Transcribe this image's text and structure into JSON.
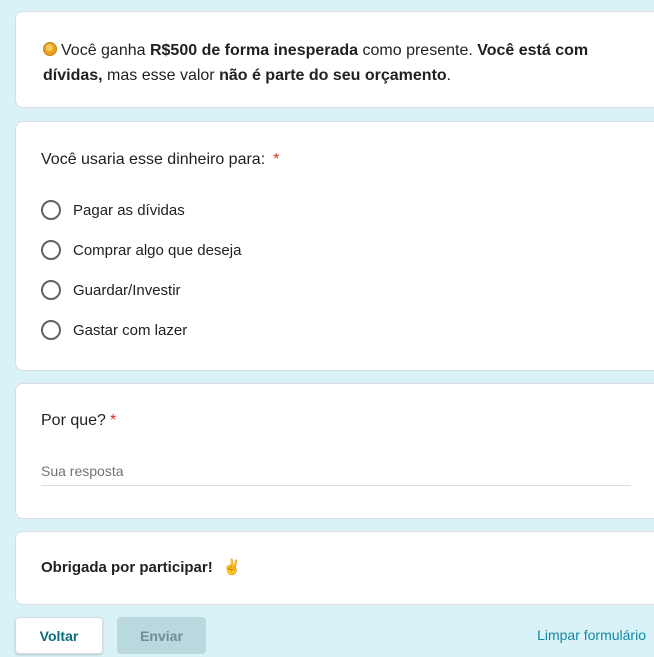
{
  "intro": {
    "text_1": "Você ganha ",
    "bold_1": "R$500 de forma inesperada",
    "text_2": " como presente. ",
    "bold_2": "Você está com dívidas,",
    "text_3": " mas esse valor ",
    "bold_3": "não é parte do seu orçamento",
    "text_4": "."
  },
  "question1": {
    "title": "Você usaria esse dinheiro para:",
    "required_mark": "*",
    "options": [
      "Pagar as dívidas",
      "Comprar algo que deseja",
      "Guardar/Investir",
      "Gastar com lazer"
    ]
  },
  "question2": {
    "title": "Por que?",
    "required_mark": "*",
    "placeholder": "Sua resposta"
  },
  "thanks": {
    "text": "Obrigada por participar!",
    "emoji": "✌"
  },
  "footer": {
    "back_label": "Voltar",
    "send_label": "Enviar",
    "clear_label": "Limpar formulário"
  },
  "colors": {
    "background": "#d9f2f7",
    "accent": "#0f8aa3",
    "required": "#d93025"
  }
}
